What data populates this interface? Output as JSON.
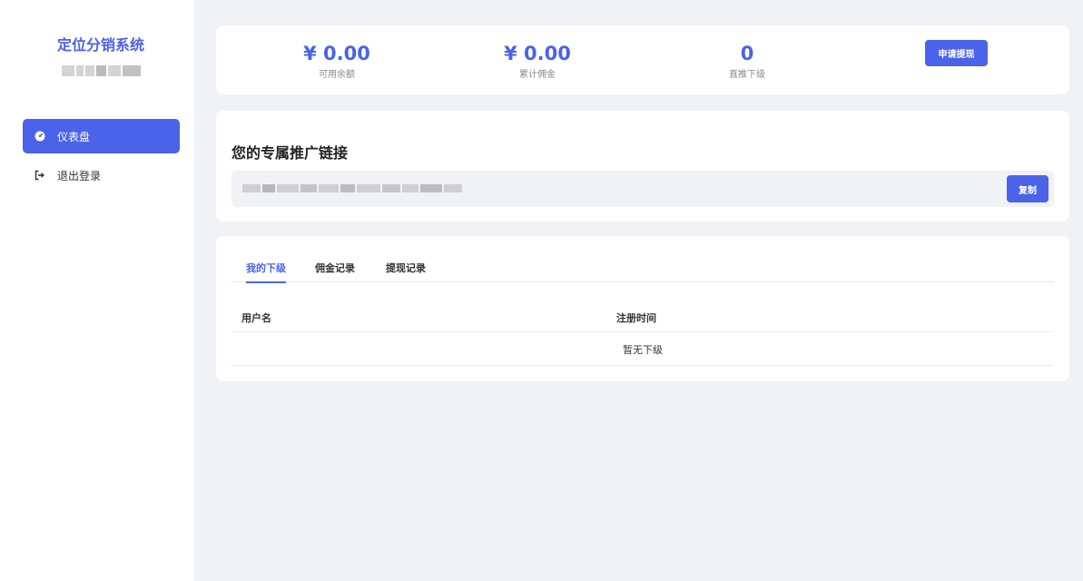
{
  "sidebar": {
    "brand": "定位分销系统",
    "items": [
      {
        "label": "仪表盘",
        "icon": "dashboard-icon",
        "active": true
      },
      {
        "label": "退出登录",
        "icon": "logout-icon",
        "active": false
      }
    ]
  },
  "stats": [
    {
      "value": "¥ 0.00",
      "label": "可用余额"
    },
    {
      "value": "¥ 0.00",
      "label": "累计佣金"
    },
    {
      "value": "0",
      "label": "直推下级"
    }
  ],
  "withdraw_button": "申请提现",
  "promo": {
    "title": "您的专属推广链接",
    "copy_button": "复制"
  },
  "tabs": [
    {
      "label": "我的下级",
      "active": true
    },
    {
      "label": "佣金记录",
      "active": false
    },
    {
      "label": "提现记录",
      "active": false
    }
  ],
  "table": {
    "headers": [
      "用户名",
      "注册时间"
    ],
    "empty_text": "暂无下级"
  },
  "colors": {
    "accent": "#4b63e8",
    "background": "#f1f2f5"
  }
}
